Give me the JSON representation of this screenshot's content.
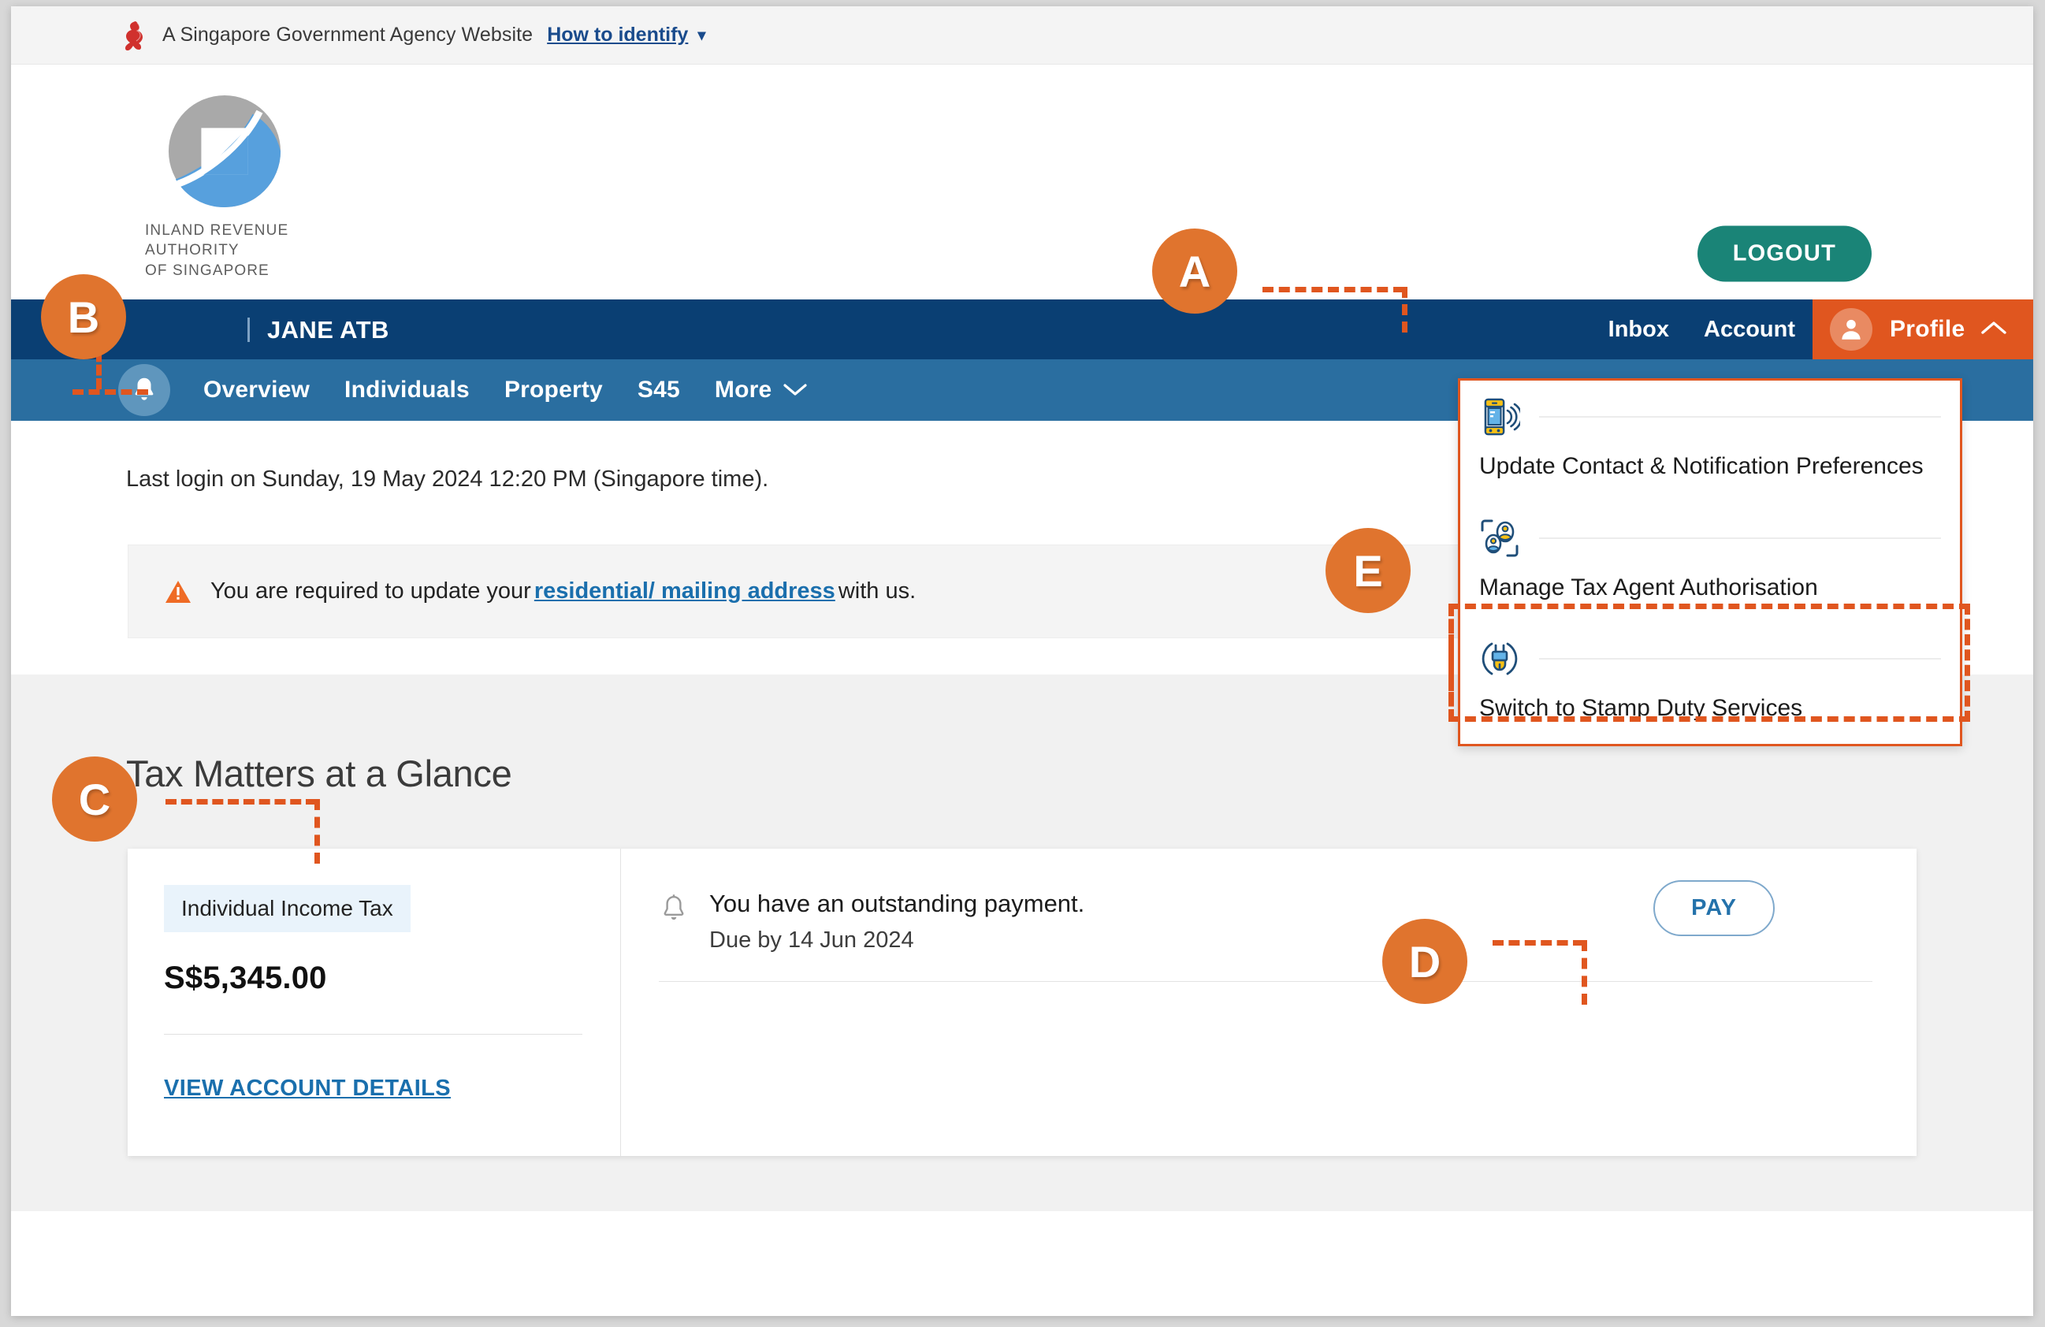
{
  "masthead": {
    "text": "A Singapore Government Agency Website",
    "how_to_identify": "How to identify",
    "caret": "chevron-down"
  },
  "branding": {
    "org_line1": "INLAND REVENUE",
    "org_line2": "AUTHORITY",
    "org_line3": "OF SINGAPORE",
    "logo_gray": "#a9a9a9",
    "logo_blue": "#57a0dd"
  },
  "header": {
    "logout_label": "LOGOUT",
    "logout_color": "#1a8477"
  },
  "topnav": {
    "user_name": "JANE ATB",
    "inbox_label": "Inbox",
    "account_label": "Account",
    "profile_label": "Profile",
    "profile_caret": "chevron-up",
    "bg_color": "#0a3f73",
    "profile_bg_color": "#e0561f"
  },
  "subnav": {
    "bg_color": "#2a6ea0",
    "items": [
      {
        "label": "Overview"
      },
      {
        "label": "Individuals"
      },
      {
        "label": "Property"
      },
      {
        "label": "S45"
      },
      {
        "label": "More"
      }
    ],
    "more_caret": "chevron-down"
  },
  "content": {
    "last_login": "Last login on Sunday, 19 May 2024 12:20 PM (Singapore time).",
    "alert": {
      "icon": "warning-triangle",
      "text_before": "You are required to update your",
      "link_text": "residential/ mailing address",
      "text_after": "with us."
    },
    "glance_title": "Tax Matters at a Glance",
    "card": {
      "tax_type": "Individual Income Tax",
      "amount": "S$5,345.00",
      "view_details_label": "VIEW ACCOUNT DETAILS",
      "notice_icon": "bell-icon",
      "notice_main": "You have an outstanding payment.",
      "notice_sub": "Due by 14 Jun 2024",
      "pay_label": "PAY"
    }
  },
  "profile_dropdown": {
    "items": [
      {
        "icon": "mobile-notification-icon",
        "label": "Update Contact & Notification Preferences"
      },
      {
        "icon": "tax-agent-authorisation-icon",
        "label": "Manage Tax Agent Authorisation"
      },
      {
        "icon": "plug-switch-icon",
        "label": "Switch to Stamp Duty Services"
      }
    ],
    "border_color": "#e0561f"
  },
  "annotations": {
    "badge_color": "#e0742e",
    "badges": [
      {
        "letter": "A",
        "target": "profile-menu-button"
      },
      {
        "letter": "B",
        "target": "notification-bell"
      },
      {
        "letter": "C",
        "target": "tax-matters-at-a-glance-title"
      },
      {
        "letter": "D",
        "target": "pay-button"
      },
      {
        "letter": "E",
        "target": "manage-tax-agent-authorisation-item"
      }
    ]
  }
}
